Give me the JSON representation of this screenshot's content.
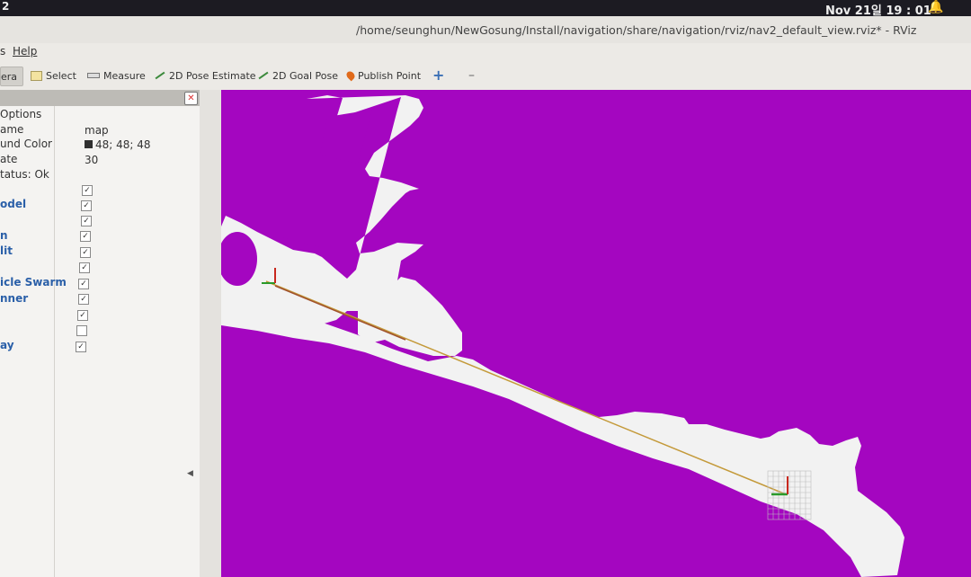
{
  "system_bar": {
    "corner": "2",
    "clock": "Nov 21일 19 : 01",
    "bell_icon": "bell-icon"
  },
  "window": {
    "title": "/home/seunghun/NewGosung/Install/navigation/share/navigation/rviz/nav2_default_view.rviz* - RViz"
  },
  "menu": {
    "left_fragment": "s",
    "help": "Help"
  },
  "toolbar": {
    "camera": "era",
    "select": "Select",
    "measure": "Measure",
    "pose_estimate": "2D Pose Estimate",
    "goal_pose": "2D Goal Pose",
    "publish_point": "Publish Point"
  },
  "displays": {
    "options_header": "Options",
    "properties": [
      {
        "name": "ame",
        "value": "map"
      },
      {
        "name": "und Color",
        "value": "48; 48; 48"
      },
      {
        "name": "ate",
        "value": "30"
      }
    ],
    "status": "tatus: Ok",
    "items": [
      {
        "label": "",
        "checked": true
      },
      {
        "label": "odel",
        "checked": true
      },
      {
        "label": "",
        "checked": true
      },
      {
        "label": "n",
        "checked": true
      },
      {
        "label": "lit",
        "checked": true
      },
      {
        "label": "",
        "checked": true
      },
      {
        "label": "icle Swarm",
        "checked": true
      },
      {
        "label": "nner",
        "checked": true
      },
      {
        "label": "",
        "checked": true
      },
      {
        "label": "",
        "checked": false
      },
      {
        "label": "ay",
        "checked": true
      }
    ]
  },
  "view": {
    "background_color": "#a406c0",
    "free_space_color": "#f2f2f2",
    "path_color": "#c49a3a"
  }
}
